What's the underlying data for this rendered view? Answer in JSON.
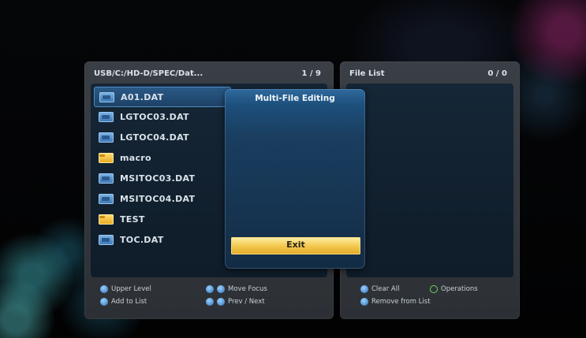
{
  "left_panel": {
    "path": "USB/C:/HD-D/SPEC/Dat...",
    "count": "1 / 9",
    "files": [
      {
        "name": "A01.DAT",
        "icon": "file-icon",
        "selected": true
      },
      {
        "name": "LGTOC03.DAT",
        "icon": "file-icon"
      },
      {
        "name": "LGTOC04.DAT",
        "icon": "file-icon"
      },
      {
        "name": "macro",
        "icon": "folder-icon"
      },
      {
        "name": "MSITOC03.DAT",
        "icon": "file-icon"
      },
      {
        "name": "MSITOC04.DAT",
        "icon": "file-icon"
      },
      {
        "name": "TEST",
        "icon": "folder-icon"
      },
      {
        "name": "TOC.DAT",
        "icon": "file-icon"
      }
    ],
    "footer": {
      "upper_level": "Upper Level",
      "move_focus": "Move Focus",
      "add_to_list": "Add to List",
      "prev_next": "Prev / Next"
    }
  },
  "right_panel": {
    "title": "File List",
    "count": "0 / 0",
    "footer": {
      "clear_all": "Clear All",
      "operations": "Operations",
      "remove_from_list": "Remove from List"
    }
  },
  "modal": {
    "title": "Multi-File Editing",
    "exit_label": "Exit"
  },
  "colors": {
    "accent": "#f2c64a",
    "selection": "#2a5a86"
  }
}
